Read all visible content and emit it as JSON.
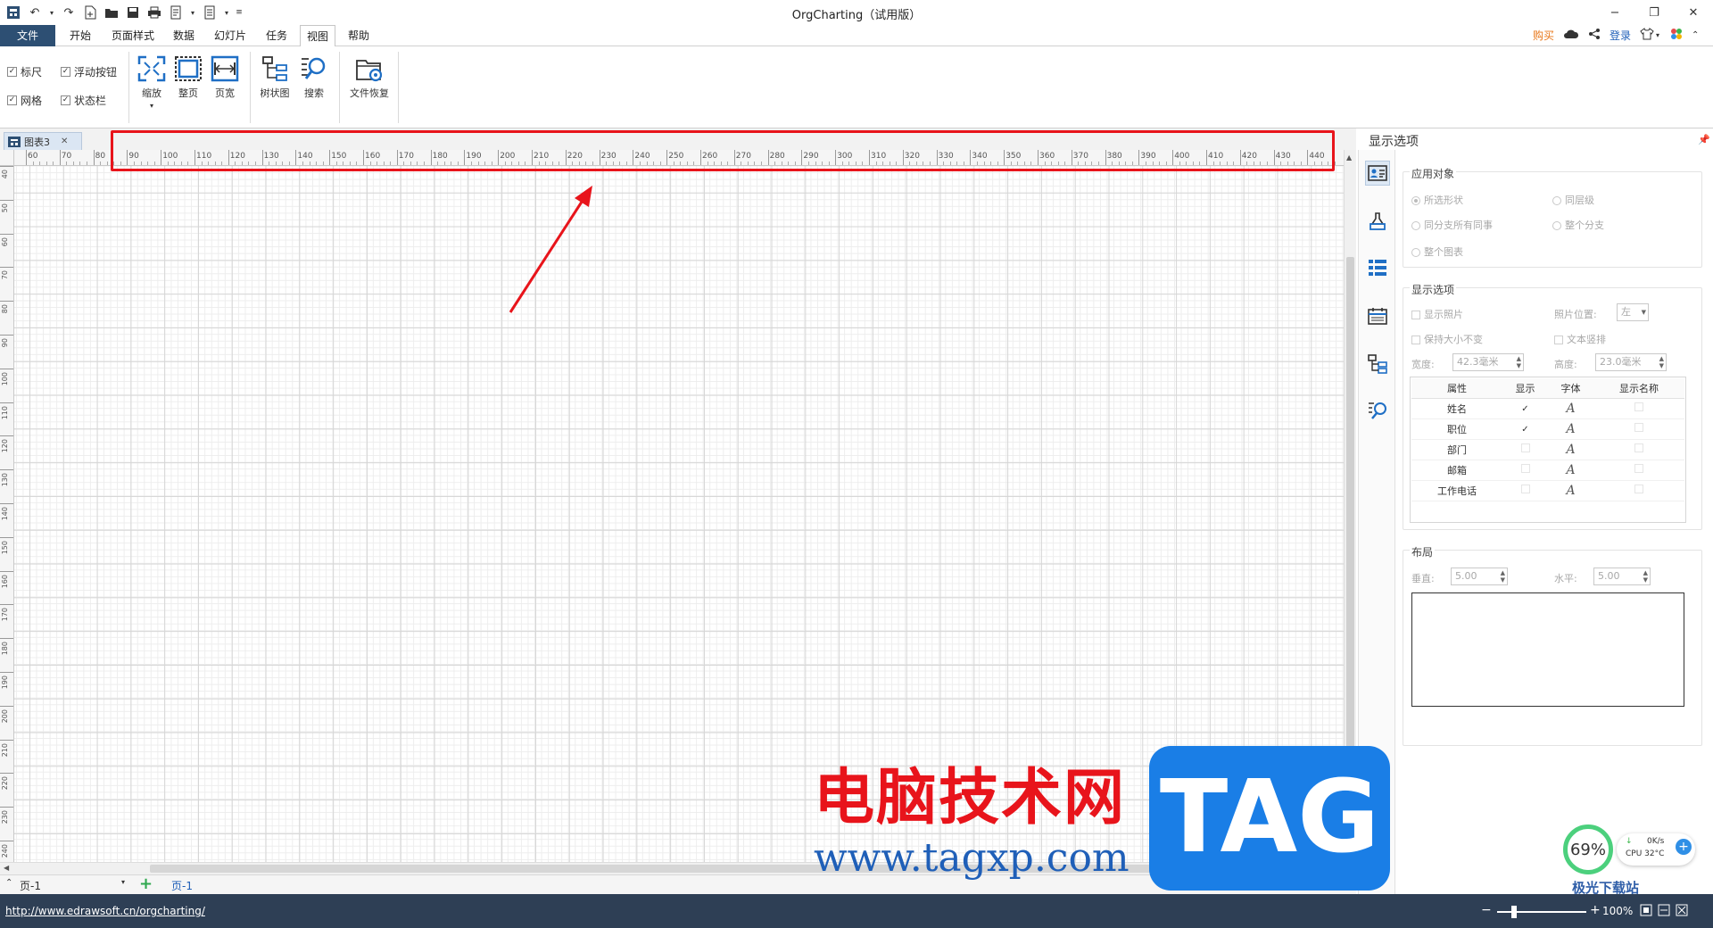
{
  "window": {
    "title": "OrgCharting（试用版）",
    "right_tools": {
      "buy": "购买",
      "login": "登录"
    }
  },
  "menu_tabs": [
    "文件",
    "开始",
    "页面样式",
    "数据",
    "幻灯片",
    "任务",
    "视图",
    "帮助"
  ],
  "active_tab": "视图",
  "ribbon": {
    "checkboxes": [
      {
        "label": "标尺",
        "checked": true
      },
      {
        "label": "网格",
        "checked": true
      },
      {
        "label": "浮动按钮",
        "checked": true
      },
      {
        "label": "状态栏",
        "checked": true
      }
    ],
    "buttons": {
      "zoom": "缩放",
      "full_page": "整页",
      "page_width": "页宽",
      "tree_view": "树状图",
      "search": "搜索",
      "file_recovery": "文件恢复"
    }
  },
  "document_tab": {
    "name": "图表3"
  },
  "ruler": {
    "h_labels": [
      "60",
      "70",
      "80",
      "90",
      "100",
      "110",
      "120",
      "130",
      "140",
      "150",
      "160",
      "170",
      "180",
      "190",
      "200",
      "210",
      "220",
      "230",
      "240",
      "250",
      "260",
      "270",
      "280",
      "290",
      "300",
      "310",
      "320",
      "330",
      "340",
      "350",
      "360",
      "370",
      "380",
      "390",
      "400",
      "410",
      "420",
      "430",
      "440"
    ],
    "v_labels": [
      "40",
      "50",
      "60",
      "70",
      "80",
      "90",
      "100",
      "110",
      "120",
      "130",
      "140",
      "150",
      "160",
      "170",
      "180",
      "190",
      "200",
      "210",
      "220",
      "230",
      "240"
    ]
  },
  "pagebar": {
    "page_selector": "页-1",
    "page_tab": "页-1"
  },
  "status": {
    "url": "http://www.edrawsoft.cn/orgcharting/",
    "zoom": "100%"
  },
  "panel": {
    "title": "显示选项",
    "apply_group": {
      "title": "应用对象",
      "options": [
        "所选形状",
        "同层级",
        "同分支所有同事",
        "整个分支",
        "整个图表"
      ]
    },
    "display_group": {
      "title": "显示选项",
      "show_photo": "显示照片",
      "photo_pos_label": "照片位置:",
      "photo_pos_value": "左",
      "keep_size": "保持大小不变",
      "vertical_text": "文本竖排",
      "width_label": "宽度:",
      "width_value": "42.3毫米",
      "height_label": "高度:",
      "height_value": "23.0毫米",
      "table_headers": [
        "属性",
        "显示",
        "字体",
        "显示名称"
      ],
      "table_rows": [
        {
          "name": "姓名",
          "show": true
        },
        {
          "name": "职位",
          "show": true
        },
        {
          "name": "部门",
          "show": false
        },
        {
          "name": "邮箱",
          "show": false
        },
        {
          "name": "工作电话",
          "show": false
        }
      ],
      "font_glyph": "A"
    },
    "layout_group": {
      "title": "布局",
      "vertical_label": "垂直:",
      "vertical_value": "5.00",
      "horizontal_label": "水平:",
      "horizontal_value": "5.00"
    }
  },
  "overlay": {
    "watermark_cn": "电脑技术网",
    "watermark_url": "www.tagxp.com",
    "watermark_tag": "TAG",
    "cpu_percent": "69%",
    "net_speed": "0K/s",
    "cpu_temp": "CPU 32°C",
    "site_logo": "极光下载站"
  },
  "colors": {
    "highlight": "#e8141b",
    "file_tab": "#2d4f73",
    "status_bar": "#2e3f55",
    "tag_blue": "#1a7ee6"
  }
}
